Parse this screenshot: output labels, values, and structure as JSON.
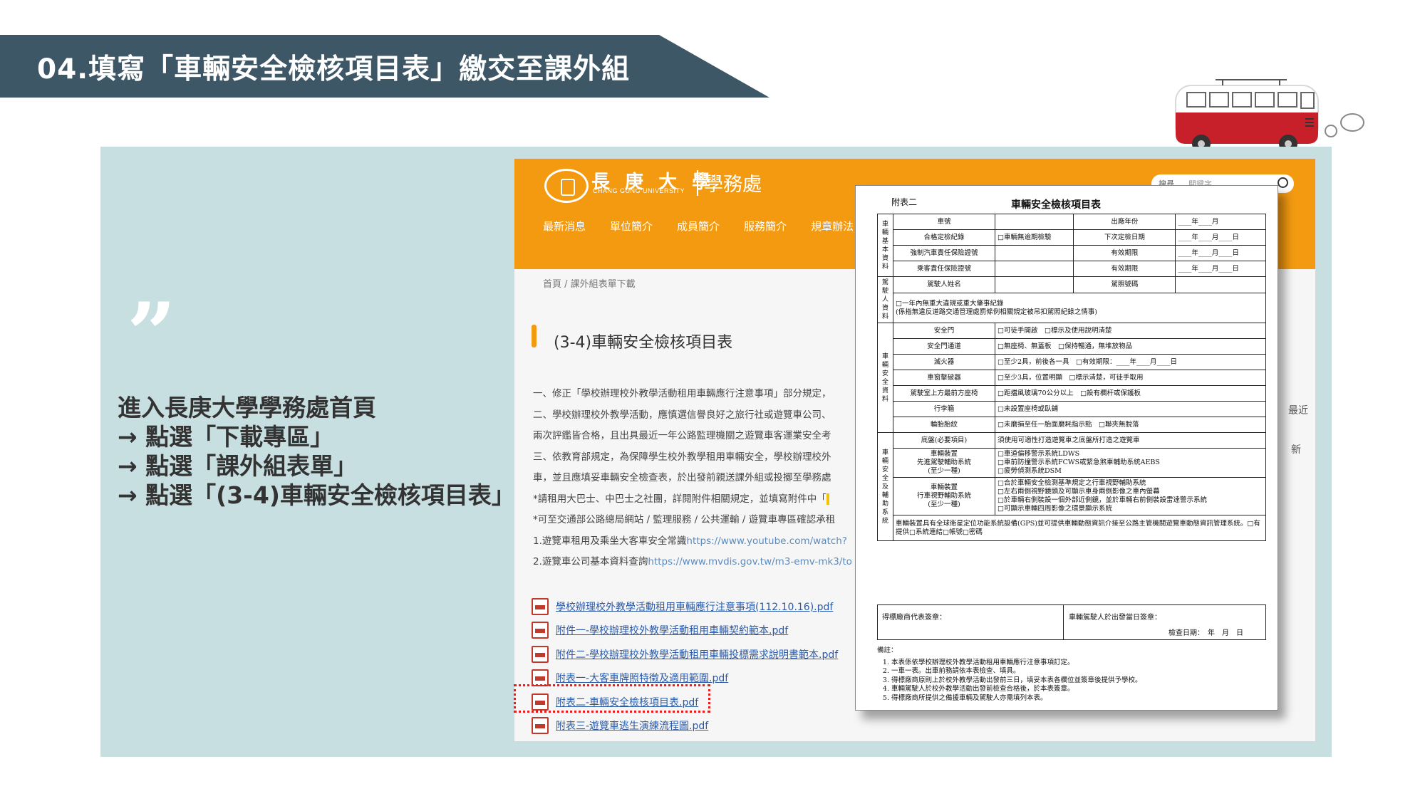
{
  "header": {
    "title": "04.填寫「車輛安全檢核項目表」繳交至課外組"
  },
  "instructions": {
    "quote_mark": "”",
    "lines": [
      "進入長庚大學學務處首頁",
      "→ 點選「下載專區」",
      "→ 點選「課外組表單」",
      "→ 點選「(3-4)車輛安全檢核項目表」"
    ]
  },
  "website": {
    "logo_zh": "長 庚 大 學",
    "logo_en": "CHANG GUNG UNIVERSITY",
    "dept": "學務處",
    "nav": [
      "最新消息",
      "單位簡介",
      "成員簡介",
      "服務簡介",
      "規章辦法"
    ],
    "search_label": "搜尋",
    "search_placeholder": "關鍵字",
    "breadcrumb": "首頁 / 課外組表單下載",
    "page_title": "(3-4)車輛安全檢核項目表",
    "body": [
      "一、修正「學校辦理校外教學活動租用車輛應行注意事項」部分規定，",
      "二、學校辦理校外教學活動，應慎選信譽良好之旅行社或遊覽車公司、",
      "兩次評鑑皆合格，且出具最近一年公路監理機關之遊覽車客運業安全考",
      "三、依教育部規定，為保障學生校外教學租用車輛安全，學校辦理校外",
      "車，並且應填妥車輛安全檢查表，於出發前親送課外組或投擲至學務處",
      "*請租用大巴士、中巴士之社團，詳閱附件相關規定，並填寫附件中「",
      "*可至交通部公路總局網站 / 監理服務 / 公共運輸 / 遊覽車專區確認承租",
      "1.遊覽車租用及乘坐大客車安全常識",
      "2.遊覽車公司基本資料查詢"
    ],
    "link1": "https://www.youtube.com/watch?",
    "link2": "https://www.mvdis.gov.tw/m3-emv-mk3/to",
    "right_cut1": "最近",
    "right_cut2": "新",
    "files": [
      "學校辦理校外教學活動租用車輛應行注意事項(112.10.16).pdf",
      "附件一-學校辦理校外教學活動租用車輛契約範本.pdf",
      "附件二-學校辦理校外教學活動租用車輛投標需求說明書範本.pdf",
      "附表一-大客車牌照特徵及適用範圍.pdf",
      "附表二-車輛安全檢核項目表.pdf",
      "附表三-遊覽車逃生演練流程圖.pdf"
    ]
  },
  "form": {
    "annex": "附表二",
    "title": "車輛安全檢核項目表",
    "sections": {
      "basic": "車輛基本資料",
      "driver": "駕駛人資料",
      "safety": "車輛安全資料",
      "assist": "車輛安全及輔助系統"
    },
    "basic_rows": [
      [
        "車號",
        "",
        "出廠年份",
        "____年____月"
      ],
      [
        "合格定檢紀錄",
        "□車輛無逾期檢驗",
        "下次定檢日期",
        "____年____月____日"
      ],
      [
        "強制汽車責任保險證號",
        "",
        "有效期限",
        "____年____月____日"
      ],
      [
        "乘客責任保險證號",
        "",
        "有效期限",
        "____年____月____日"
      ]
    ],
    "driver_row": [
      "駕駛人姓名",
      "",
      "駕照號碼",
      ""
    ],
    "driver_note1": "□一年內無重大違規或重大肇事紀錄",
    "driver_note2": "(係指無違反道路交通管理處罰條例相關規定被吊扣駕照紀錄之情事)",
    "safety_rows": [
      [
        "安全門",
        "□可徒手開啟　□標示及使用說明清楚"
      ],
      [
        "安全門通道",
        "□無座椅、無蓋板　□保持暢通，無堆放物品"
      ],
      [
        "滅火器",
        "□至少2具，前後各一具　□有效期限：____年____月____日"
      ],
      [
        "車窗擊破器",
        "□至少3具，位置明顯　□標示清楚，可徒手取用"
      ],
      [
        "駕駛室上方最前方座椅",
        "□距擋風玻璃70公分以上　□設有欄杆或保護板"
      ],
      [
        "行李箱",
        "□未設置座椅或臥鋪"
      ],
      [
        "輪胎胎紋",
        "□未磨損至任一胎面磨耗指示點　□聯夾無脫落"
      ]
    ],
    "assist_rows": [
      [
        "底盤(必要項目)",
        "須使用可適性打造遊覽車之底盤所打造之遊覽車"
      ],
      [
        "車輛裝置\n先進駕駛輔助系統\n(至少一種)",
        "□車道偏移警示系統LDWS\n□車前防撞警示系統FCWS或緊急煞車輔助系統AEBS\n□疲勞偵測系統DSM"
      ],
      [
        "車輛裝置\n行車視野輔助系統\n(至少一種)",
        "□合於車輛安全檢測基準規定之行車視野輔助系統\n□左右兩側視野鏡頭及可顯示車身兩側影像之車內螢幕\n□於車輛右側裝設一個外部近側鏡，並於車輛右前側裝設雷達警示系統\n□可顯示車輛四周影像之環景顯示系統"
      ]
    ],
    "gps_note": "車輛裝置具有全球衛星定位功能系統設備(GPS)並可提供車輛動態資訊介接至公路主管機關遊覽車動態資訊管理系統。□有提供□系統連結□帳號□密碼",
    "sign_left": "得標廠商代表簽章：",
    "sign_right": "車輛駕駛人於出發當日簽章：",
    "sign_date": "檢查日期：　年　月　日",
    "notes_title": "備註：",
    "notes": [
      "本表係依學校辦理校外教學活動租用車輛應行注意事項訂定。",
      "一車一表。出車前務請依本表檢查、填具。",
      "得標廠商原則上於校外教學活動出發前三日，填妥本表各欄位並簽章後提供予學校。",
      "車輛駕駛人於校外教學活動出發前檢查合格後，於本表簽章。",
      "得標廠商所提供之備援車輛及駕駛人亦需填列本表。"
    ]
  },
  "colors": {
    "banner": "#3e5766",
    "panel": "#c8dfe1",
    "site_header": "#f39a10",
    "bus_red": "#c8202a"
  }
}
